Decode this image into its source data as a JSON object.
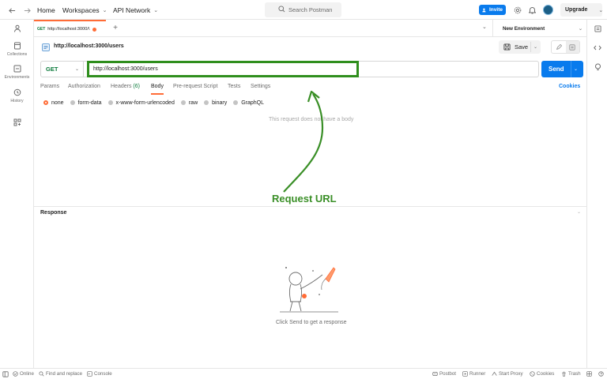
{
  "topbar": {
    "home": "Home",
    "workspaces": "Workspaces",
    "api_network": "API Network",
    "search_placeholder": "Search Postman",
    "invite": "Invite",
    "upgrade": "Upgrade"
  },
  "sidebar": {
    "items": [
      {
        "label": "",
        "icon": "user-icon"
      },
      {
        "label": "Collections",
        "icon": "collections-icon"
      },
      {
        "label": "Environments",
        "icon": "environments-icon"
      },
      {
        "label": "History",
        "icon": "history-icon"
      },
      {
        "label": "",
        "icon": "apps-icon"
      }
    ]
  },
  "tabs": {
    "active": {
      "method": "GET",
      "title": "http://localhost:3000/\\"
    },
    "environment": "New Environment"
  },
  "request": {
    "title": "http://localhost:3000/users",
    "save": "Save",
    "method": "GET",
    "url": "http://localhost:3000/users",
    "send": "Send",
    "cookies": "Cookies",
    "tabs": [
      {
        "label": "Params"
      },
      {
        "label": "Authorization"
      },
      {
        "label": "Headers",
        "count": "(6)"
      },
      {
        "label": "Body"
      },
      {
        "label": "Pre-request Script"
      },
      {
        "label": "Tests"
      },
      {
        "label": "Settings"
      }
    ],
    "active_tab": "Body",
    "body_types": [
      "none",
      "form-data",
      "x-www-form-urlencoded",
      "raw",
      "binary",
      "GraphQL"
    ],
    "selected_body_type": "none",
    "empty_message": "This request does not have a body"
  },
  "annotation": {
    "label": "Request URL",
    "color": "#3a8f27"
  },
  "response": {
    "title": "Response",
    "hint": "Click Send to get a response"
  },
  "statusbar": {
    "online": "Online",
    "find_replace": "Find and replace",
    "console": "Console",
    "postbot": "Postbot",
    "runner": "Runner",
    "start_proxy": "Start Proxy",
    "cookies": "Cookies",
    "trash": "Trash"
  },
  "colors": {
    "accent": "#ff6c37",
    "primary": "#097bed",
    "get_method": "#0a7a3a",
    "highlight": "#2f8e1d"
  }
}
